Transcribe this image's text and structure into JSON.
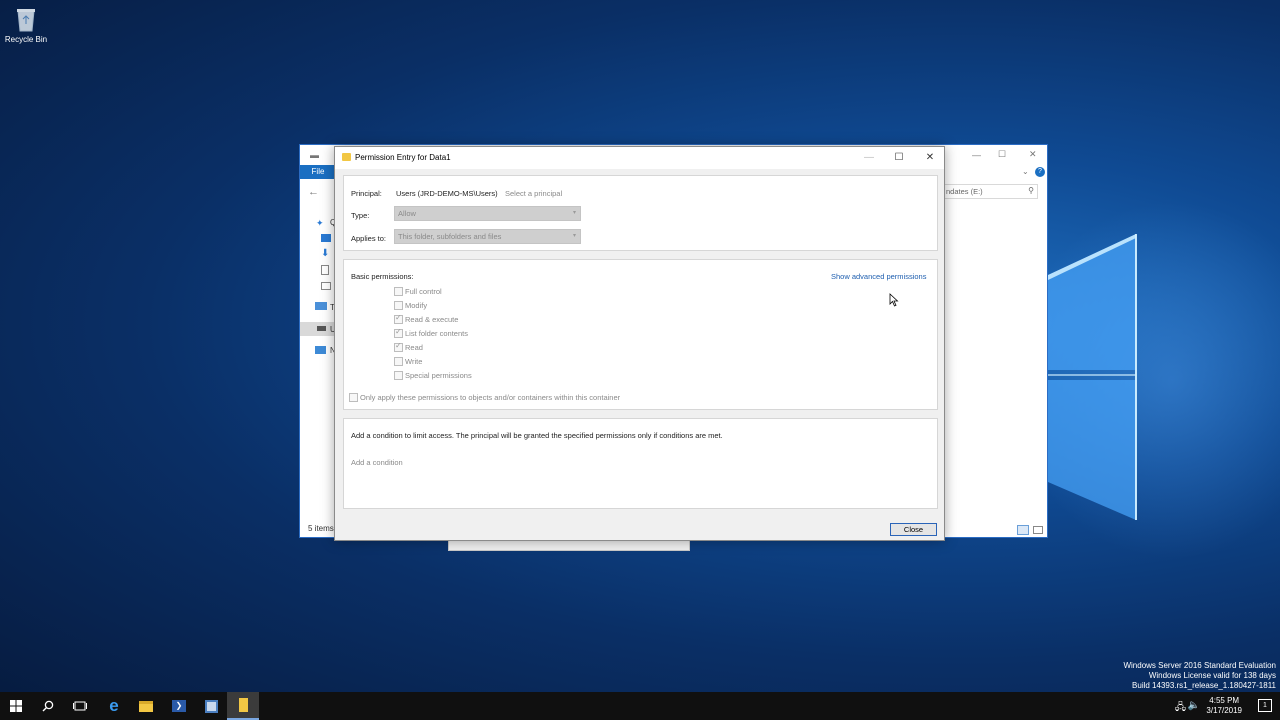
{
  "desktop": {
    "recycle_bin_label": "Recycle Bin",
    "watermark": [
      "Windows Server 2016 Standard Evaluation",
      "Windows License valid for 138 days",
      "Build 14393.rs1_release_1.180427-1811"
    ]
  },
  "explorer": {
    "file_tab": "File",
    "address_text": "ndates (E:)",
    "status_items": "5 items",
    "sidebar_letters": [
      "Q",
      "T",
      "U",
      "N"
    ]
  },
  "dialog": {
    "title": "Permission Entry for Data1",
    "principal_label": "Principal:",
    "principal_value": "Users (JRD-DEMO-MS\\Users)",
    "select_principal_link": "Select a principal",
    "type_label": "Type:",
    "type_value": "Allow",
    "applies_to_label": "Applies to:",
    "applies_to_value": "This folder, subfolders and files",
    "basic_permissions_label": "Basic permissions:",
    "show_advanced_link": "Show advanced permissions",
    "permissions": [
      {
        "label": "Full control",
        "checked": false
      },
      {
        "label": "Modify",
        "checked": false
      },
      {
        "label": "Read & execute",
        "checked": true
      },
      {
        "label": "List folder contents",
        "checked": true
      },
      {
        "label": "Read",
        "checked": true
      },
      {
        "label": "Write",
        "checked": false
      },
      {
        "label": "Special permissions",
        "checked": false
      }
    ],
    "only_apply_label": "Only apply these permissions to objects and/or containers within this container",
    "condition_text": "Add a condition to limit access. The principal will be granted the specified permissions only if conditions are met.",
    "add_condition_link": "Add a condition",
    "close_button": "Close"
  },
  "taskbar": {
    "clock_time": "4:55 PM",
    "clock_date": "3/17/2019",
    "notification_count": "1"
  },
  "colors": {
    "accent": "#1a6fc2",
    "link": "#2060b0",
    "taskbar": "#101010"
  }
}
